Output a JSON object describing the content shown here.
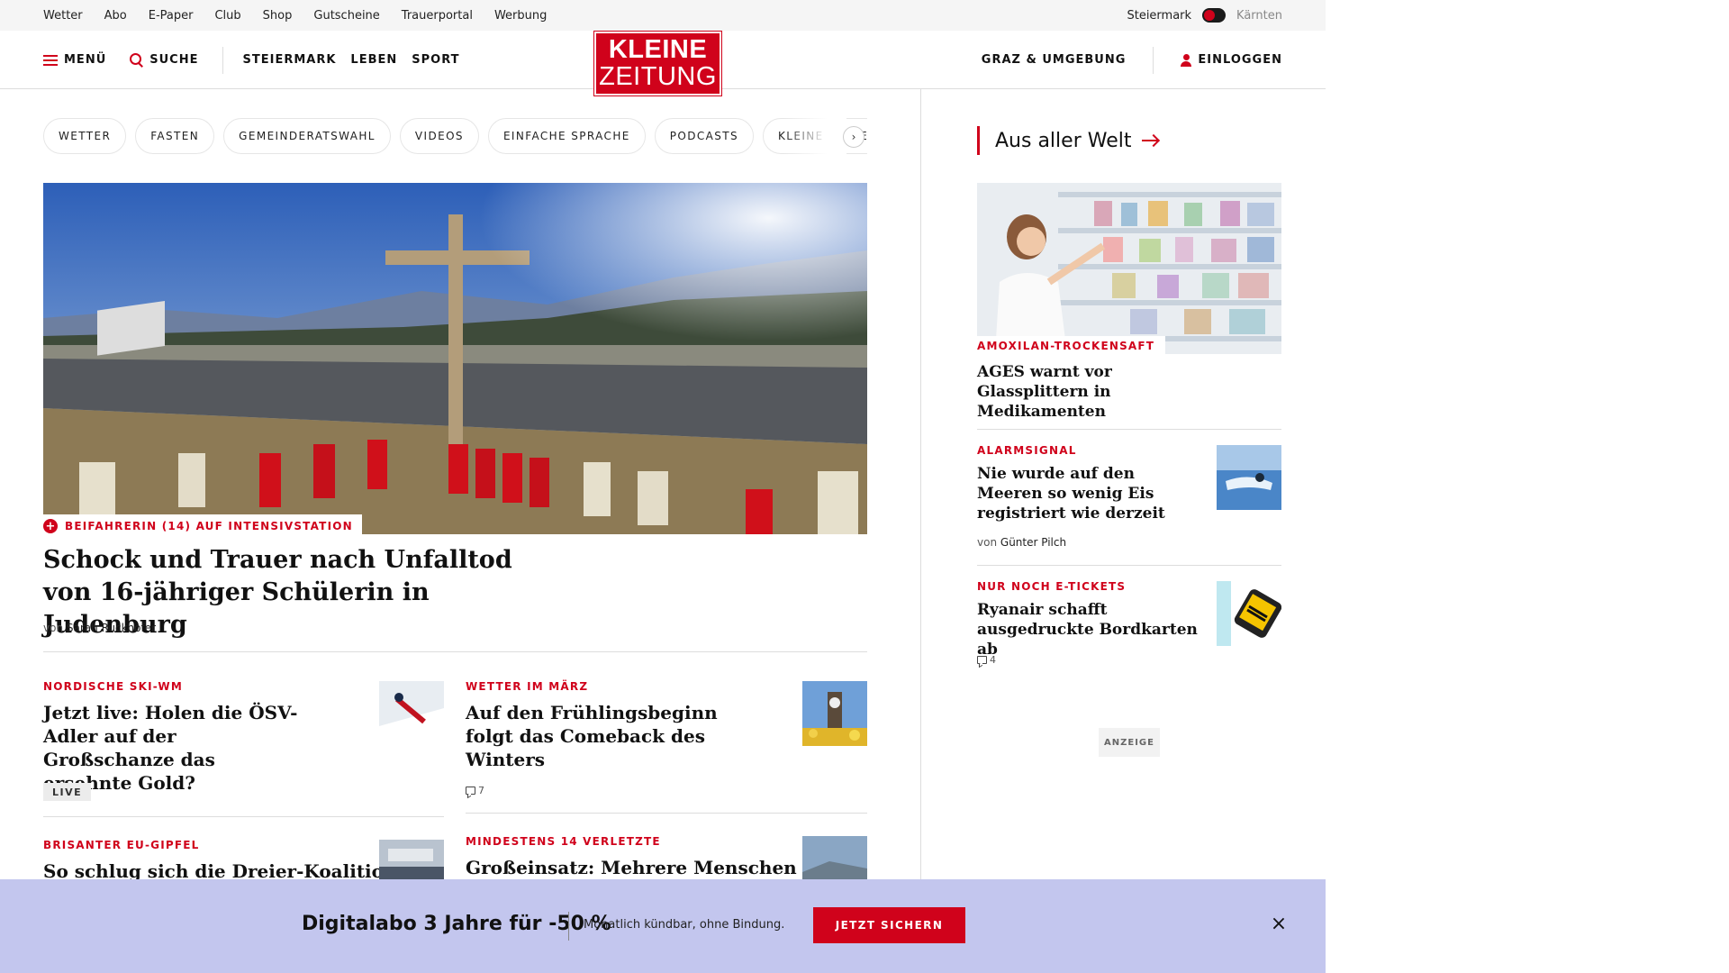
{
  "utility_links": [
    "Wetter",
    "Abo",
    "E-Paper",
    "Club",
    "Shop",
    "Gutscheine",
    "Trauerportal",
    "Werbung"
  ],
  "region": {
    "active": "Steiermark",
    "inactive": "Kärnten"
  },
  "header": {
    "menu": "MENÜ",
    "search": "SUCHE",
    "nav": [
      "STEIERMARK",
      "LEBEN",
      "SPORT"
    ],
    "logo_line1": "KLEINE",
    "logo_line2": "ZEITUNG",
    "local": "GRAZ & UMGEBUNG",
    "login": "EINLOGGEN"
  },
  "chips": [
    "WETTER",
    "FASTEN",
    "GEMEINDERATSWAHL",
    "VIDEOS",
    "EINFACHE SPRACHE",
    "PODCASTS",
    "KLEINE KINDE"
  ],
  "hero": {
    "kicker": "BEIFAHRERIN (14) AUF INTENSIVSTATION",
    "title": "Schock und Trauer nach Unfalltod von 16-jähriger Schülerin in Judenburg",
    "by": "von",
    "author": "Sarah Ruckhofer"
  },
  "teasers": [
    {
      "kicker": "NORDISCHE SKI-WM",
      "title": "Jetzt live: Holen die ÖSV-Adler auf der Großschanze das ersehnte Gold?",
      "badge": "LIVE"
    },
    {
      "kicker": "WETTER IM MÄRZ",
      "title": "Auf den Frühlingsbeginn folgt das Comeback des Winters",
      "comments": "7"
    },
    {
      "kicker": "BRISANTER EU-GIPFEL",
      "title": "So schlug sich die Dreier-Koalition"
    },
    {
      "kicker": "MINDESTENS 14 VERLETZTE",
      "title": "Großeinsatz: Mehrere Menschen"
    }
  ],
  "sidebar": {
    "title": "Aus aller Welt",
    "items": [
      {
        "kicker": "AMOXILAN-TROCKENSAFT",
        "title": "AGES warnt vor Glassplittern in Medikamenten"
      },
      {
        "kicker": "ALARMSIGNAL",
        "title": "Nie wurde auf den Meeren so wenig Eis registriert wie derzeit",
        "by": "von",
        "author": "Günter Pilch"
      },
      {
        "kicker": "NUR NOCH E-TICKETS",
        "title": "Ryanair schafft ausgedruckte Bordkarten ab",
        "comments": "4"
      }
    ],
    "ad_label": "ANZEIGE"
  },
  "banner": {
    "title": "Digitalabo 3 Jahre für -50 %",
    "subtitle": "Monatlich kündbar, ohne Bindung.",
    "cta": "JETZT SICHERN",
    "close": "×"
  },
  "colors": {
    "brand": "#d0021b",
    "banner_bg": "#c3c6ee"
  }
}
